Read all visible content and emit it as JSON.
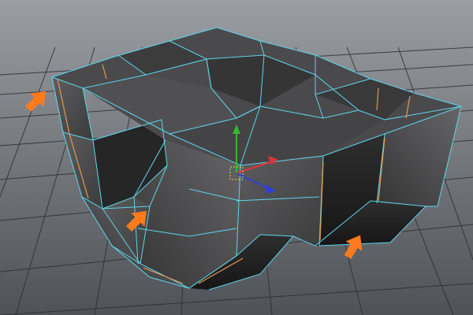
{
  "viewport": {
    "name": "3d-viewport",
    "background_top": "#9a9ea3",
    "background_bottom": "#4f5358",
    "grid_color": "#2b2d30"
  },
  "mesh": {
    "face_color": "#3f3f40",
    "edge_color": "#5fd5ea",
    "seam_color": "#e29a4b"
  },
  "gizmo": {
    "x_color": "#e0333d",
    "y_color": "#35b835",
    "z_color": "#2f3fd8",
    "pivot_color": "#e8d64a"
  },
  "annotations": {
    "arrow_color": "#ff7a1c",
    "icon": "arrow-icon",
    "count": 3
  }
}
